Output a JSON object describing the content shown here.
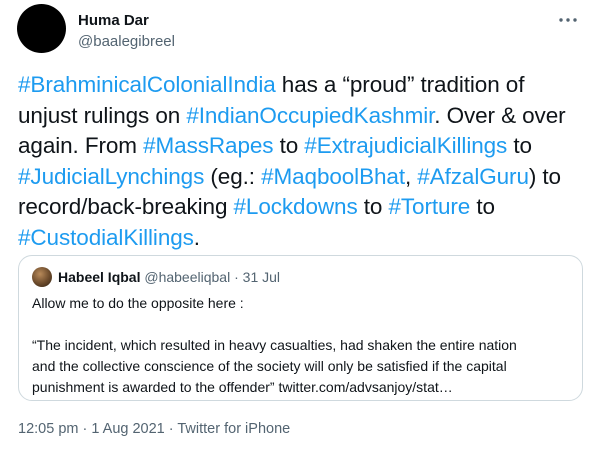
{
  "author": {
    "name": "Huma Dar",
    "handle": "@baalegibreel"
  },
  "menu": {
    "icon": "more-horizontal-icon"
  },
  "tweet": {
    "t1": "#BrahminicalColonialIndia",
    "t2": " has a “proud” tradition of unjust rulings on ",
    "t3": "#IndianOccupiedKashmir",
    "t4": ". Over & over again. From ",
    "t5": "#MassRapes",
    "t6": " to ",
    "t7": "#ExtrajudicialKillings",
    "t8": " to ",
    "t9": "#JudicialLynchings",
    "t10": " (eg.: ",
    "t11": "#MaqboolBhat",
    "t12": ", ",
    "t13": "#AfzalGuru",
    "t14": ") to record/back-breaking ",
    "t15": "#Lockdowns",
    "t16": " to ",
    "t17": "#Torture",
    "t18": " to ",
    "t19": "#CustodialKillings",
    "t20": "."
  },
  "quote": {
    "name": "Habeel Iqbal",
    "handle": "@habeeliqbal",
    "separator": "·",
    "date": "31 Jul",
    "line1": "Allow me to do the opposite here :",
    "line2": "“The incident, which resulted in heavy casualties, had shaken the entire nation",
    "line3": "and the collective conscience of the society will only be satisfied if the capital",
    "line4": "punishment is awarded to the offender” twitter.com/advsanjoy/stat…"
  },
  "footer": {
    "time": "12:05 pm",
    "sep1": " · ",
    "date": "1 Aug 2021",
    "sep2": " · ",
    "source": "Twitter for iPhone"
  },
  "colors": {
    "link": "#1d9bf0",
    "text": "#0f1419",
    "secondary": "#536471",
    "border": "#cfd9de"
  }
}
